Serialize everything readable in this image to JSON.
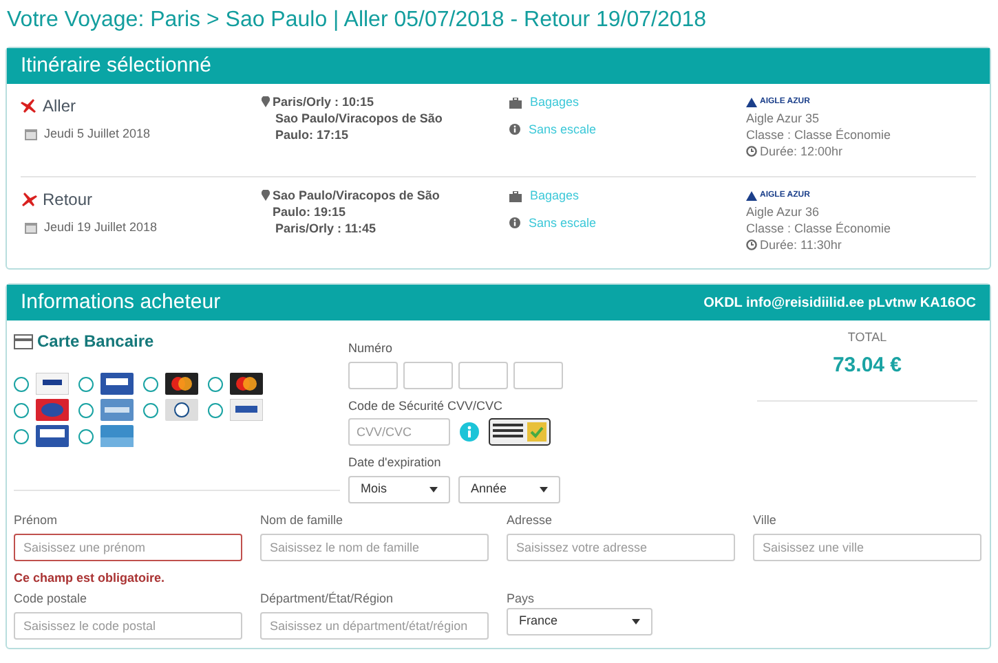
{
  "page_title": "Votre Voyage: Paris > Sao Paulo | Aller 05/07/2018 - Retour 19/07/2018",
  "itinerary": {
    "title": "Itinéraire sélectionné",
    "flights": [
      {
        "kind": "outbound",
        "direction": "Aller",
        "date": "Jeudi 5 Juillet 2018",
        "departure": "Paris/Orly : 10:15",
        "arrival": "Sao Paulo/Viracopos de São Paulo: 17:15",
        "baggage": "Bagages",
        "stops": "Sans escale",
        "airline_logo": "AIGLE AZUR",
        "flight": "Aigle Azur 35",
        "class": "Classe : Classe Économie",
        "duration": "Durée: 12:00hr"
      },
      {
        "kind": "return",
        "direction": "Retour",
        "date": "Jeudi 19 Juillet 2018",
        "departure": "Sao Paulo/Viracopos de São Paulo: 19:15",
        "arrival": "Paris/Orly : 11:45",
        "baggage": "Bagages",
        "stops": "Sans escale",
        "airline_logo": "AIGLE AZUR",
        "flight": "Aigle Azur 36",
        "class": "Classe : Classe Économie",
        "duration": "Durée: 11:30hr"
      }
    ]
  },
  "buyer": {
    "title": "Informations acheteur",
    "reference": "OKDL info@reisidiilid.ee pLvtnw KA16OC",
    "payment_method": "Carte Bancaire",
    "card_options": [
      {
        "kind": "visa",
        "selected": false
      },
      {
        "kind": "visa-debit",
        "selected": false
      },
      {
        "kind": "mastercard",
        "selected": false
      },
      {
        "kind": "mastercard",
        "selected": false
      },
      {
        "kind": "maestro",
        "selected": false
      },
      {
        "kind": "amex",
        "selected": false
      },
      {
        "kind": "diners",
        "selected": false
      },
      {
        "kind": "generic",
        "selected": false
      },
      {
        "kind": "visa-electron",
        "selected": false
      },
      {
        "kind": "carte-bleue",
        "selected": false
      }
    ],
    "number_label": "Numéro",
    "cvv_label": "Code de Sécurité CVV/CVC",
    "cvv_placeholder": "CVV/CVC",
    "expiry_label": "Date d'expiration",
    "expiry_selects": [
      "Mois",
      "Année"
    ],
    "total_label": "TOTAL",
    "total": "73.04 €",
    "fields": [
      {
        "label": "Prénom",
        "placeholder": "Saisissez une prénom",
        "invalid": true,
        "error": "Ce champ est obligatoire."
      },
      {
        "label": "Nom de famille",
        "placeholder": "Saisissez le nom de famille",
        "invalid": false
      },
      {
        "label": "Adresse",
        "placeholder": "Saisissez votre adresse",
        "invalid": false
      },
      {
        "label": "Ville",
        "placeholder": "Saisissez une ville",
        "invalid": false
      },
      {
        "label": "Code postale",
        "placeholder": "Saisissez le code postal",
        "invalid": false
      },
      {
        "label": "Départment/État/Région",
        "placeholder": "Saisissez un départment/état/région",
        "invalid": false
      },
      {
        "kind": "select",
        "label": "Pays",
        "value": "France",
        "invalid": false
      }
    ]
  }
}
